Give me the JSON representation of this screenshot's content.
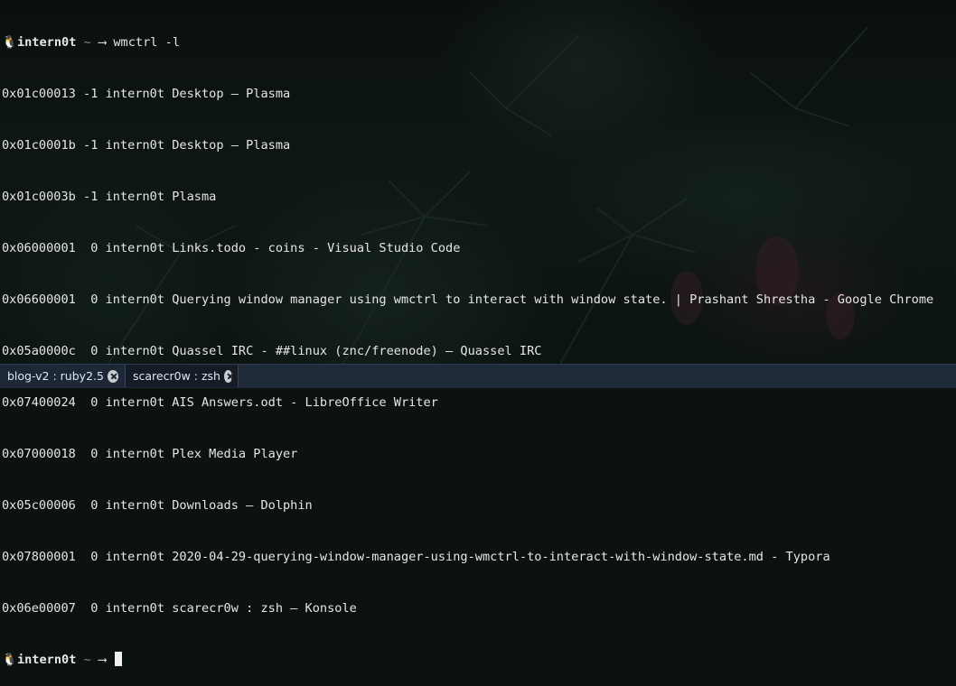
{
  "terminal": {
    "prompt_user": "intern0t",
    "prompt_dir": "~",
    "prompt_arrow": "⟶",
    "command": "wmctrl -l",
    "output": [
      "0x01c00013 -1 intern0t Desktop — Plasma",
      "0x01c0001b -1 intern0t Desktop — Plasma",
      "0x01c0003b -1 intern0t Plasma",
      "0x06000001  0 intern0t Links.todo - coins - Visual Studio Code",
      "0x06600001  0 intern0t Querying window manager using wmctrl to interact with window state. | Prashant Shrestha - Google Chrome",
      "0x05a0000c  0 intern0t Quassel IRC - ##linux (znc/freenode) — Quassel IRC",
      "0x07400024  0 intern0t AIS Answers.odt - LibreOffice Writer",
      "0x07000018  0 intern0t Plex Media Player",
      "0x05c00006  0 intern0t Downloads — Dolphin",
      "0x07800001  0 intern0t 2020-04-29-querying-window-manager-using-wmctrl-to-interact-with-window-state.md - Typora",
      "0x06e00007  0 intern0t scarecr0w : zsh — Konsole"
    ],
    "prompt_icon": "tux-icon"
  },
  "tabs": [
    {
      "label": "blog-v2 : ruby2.5",
      "close_icon": "close-icon"
    },
    {
      "label": "scarecr0w : zsh",
      "close_icon": "close-icon"
    }
  ],
  "colors": {
    "background": "#0b1210",
    "text": "#e6e6e6",
    "tabbar": "#1f2a38"
  }
}
